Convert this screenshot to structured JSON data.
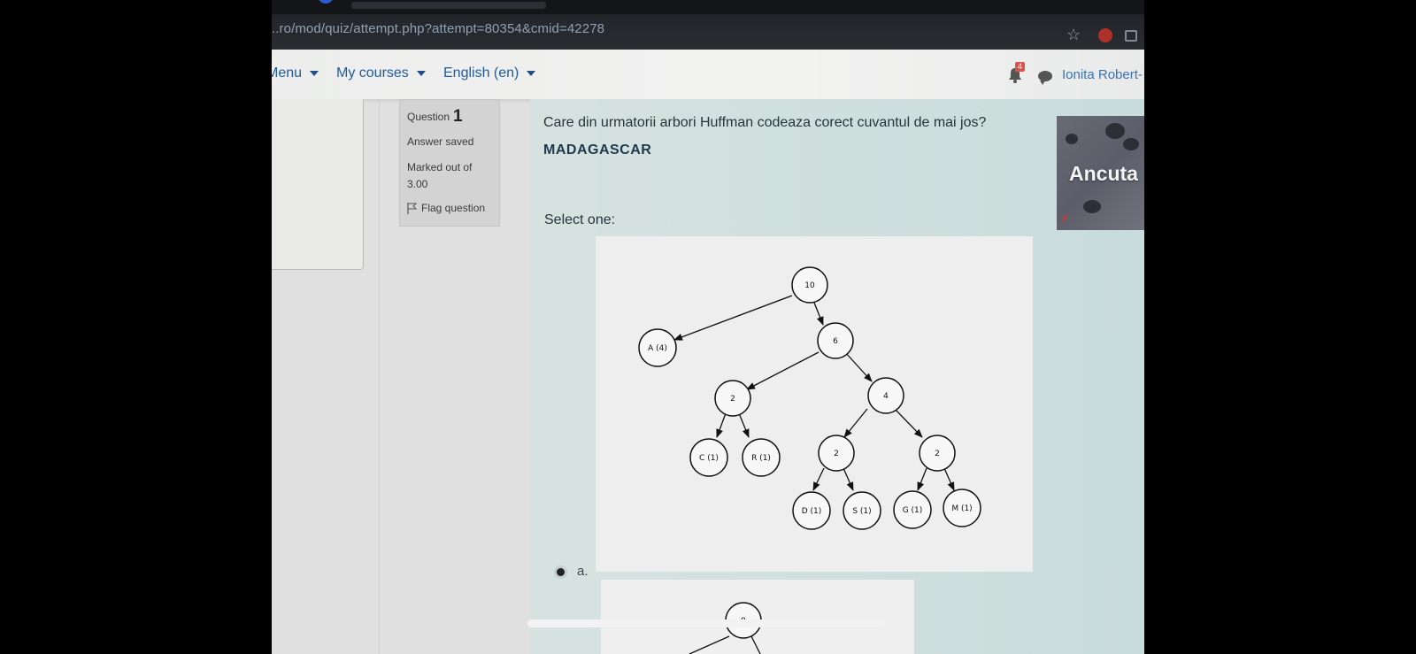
{
  "browser": {
    "url": "..ro/mod/quiz/attempt.php?attempt=80354&cmid=42278"
  },
  "nav": {
    "menu_label": "Menu",
    "courses_label": "My courses",
    "language_label": "English (en)",
    "notification_count": "4",
    "user_name": "Ionita Robert-"
  },
  "question_info": {
    "question_label": "Question",
    "question_number": "1",
    "status": "Answer saved",
    "marked_label": "Marked out of",
    "marked_value": "3.00",
    "flag_label": "Flag question"
  },
  "question": {
    "text": "Care din urmatorii arbori Huffman codeaza corect cuvantul de mai jos?",
    "word": "MADAGASCAR",
    "select_prompt": "Select one:",
    "option_a_label": "a."
  },
  "tree_a": {
    "nodes": {
      "root": "10",
      "a": "A (4)",
      "n6": "6",
      "n2left": "2",
      "n4": "4",
      "c": "C (1)",
      "r": "R (1)",
      "n2mid": "2",
      "n2right": "2",
      "d": "D (1)",
      "s": "S (1)",
      "g": "G (1)",
      "m": "M (1)"
    }
  },
  "tree_b": {
    "root": "9"
  },
  "video": {
    "participant_name": "Ancuta"
  }
}
